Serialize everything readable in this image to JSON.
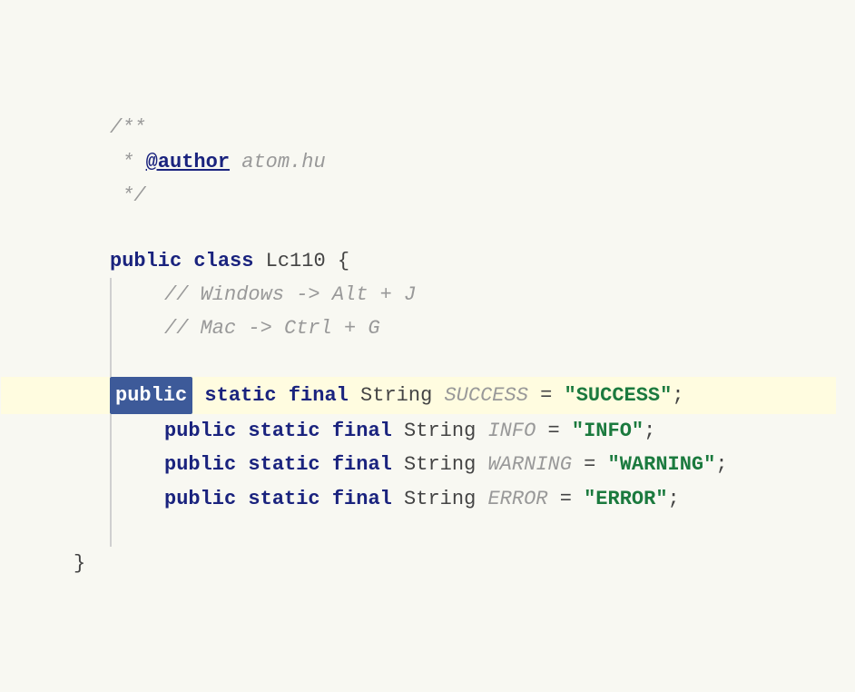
{
  "code": {
    "bg_color": "#f8f8f2",
    "highlight_bg": "#fffce0",
    "lines": [
      {
        "id": "javadoc-open",
        "type": "comment",
        "text": "/**"
      },
      {
        "id": "javadoc-author",
        "type": "author-line",
        "tag": "@author",
        "value": "atom.hu"
      },
      {
        "id": "javadoc-close",
        "type": "comment-close",
        "text": "*/"
      },
      {
        "id": "blank1",
        "type": "blank"
      },
      {
        "id": "class-decl",
        "type": "class-decl",
        "keyword": "public class",
        "name": "Lc110",
        "brace": " {"
      },
      {
        "id": "comment1",
        "type": "comment-indent",
        "text": "// Windows -> Alt + J"
      },
      {
        "id": "comment2",
        "type": "comment-indent",
        "text": "// Mac -> Ctrl + G"
      },
      {
        "id": "blank2",
        "type": "blank"
      },
      {
        "id": "field1",
        "type": "field-highlighted",
        "keyword": "public",
        "rest": " static final",
        "type_name": " String",
        "var": " SUCCESS",
        "assign": " =",
        "value": " \"SUCCESS\"",
        "semi": ";"
      },
      {
        "id": "field2",
        "type": "field",
        "keyword": "public",
        "rest": " static final",
        "type_name": " String",
        "var": " INFO",
        "assign": " =",
        "value": " \"INFO\"",
        "semi": ";"
      },
      {
        "id": "field3",
        "type": "field",
        "keyword": "public",
        "rest": " static final",
        "type_name": " String",
        "var": " WARNING",
        "assign": " =",
        "value": " \"WARNING\"",
        "semi": ";"
      },
      {
        "id": "field4",
        "type": "field",
        "keyword": "public",
        "rest": " static final",
        "type_name": " String",
        "var": " ERROR",
        "assign": " =",
        "value": " \"ERROR\"",
        "semi": ";"
      },
      {
        "id": "blank3",
        "type": "blank"
      },
      {
        "id": "closing-brace",
        "type": "closing-brace",
        "text": "}"
      }
    ]
  }
}
